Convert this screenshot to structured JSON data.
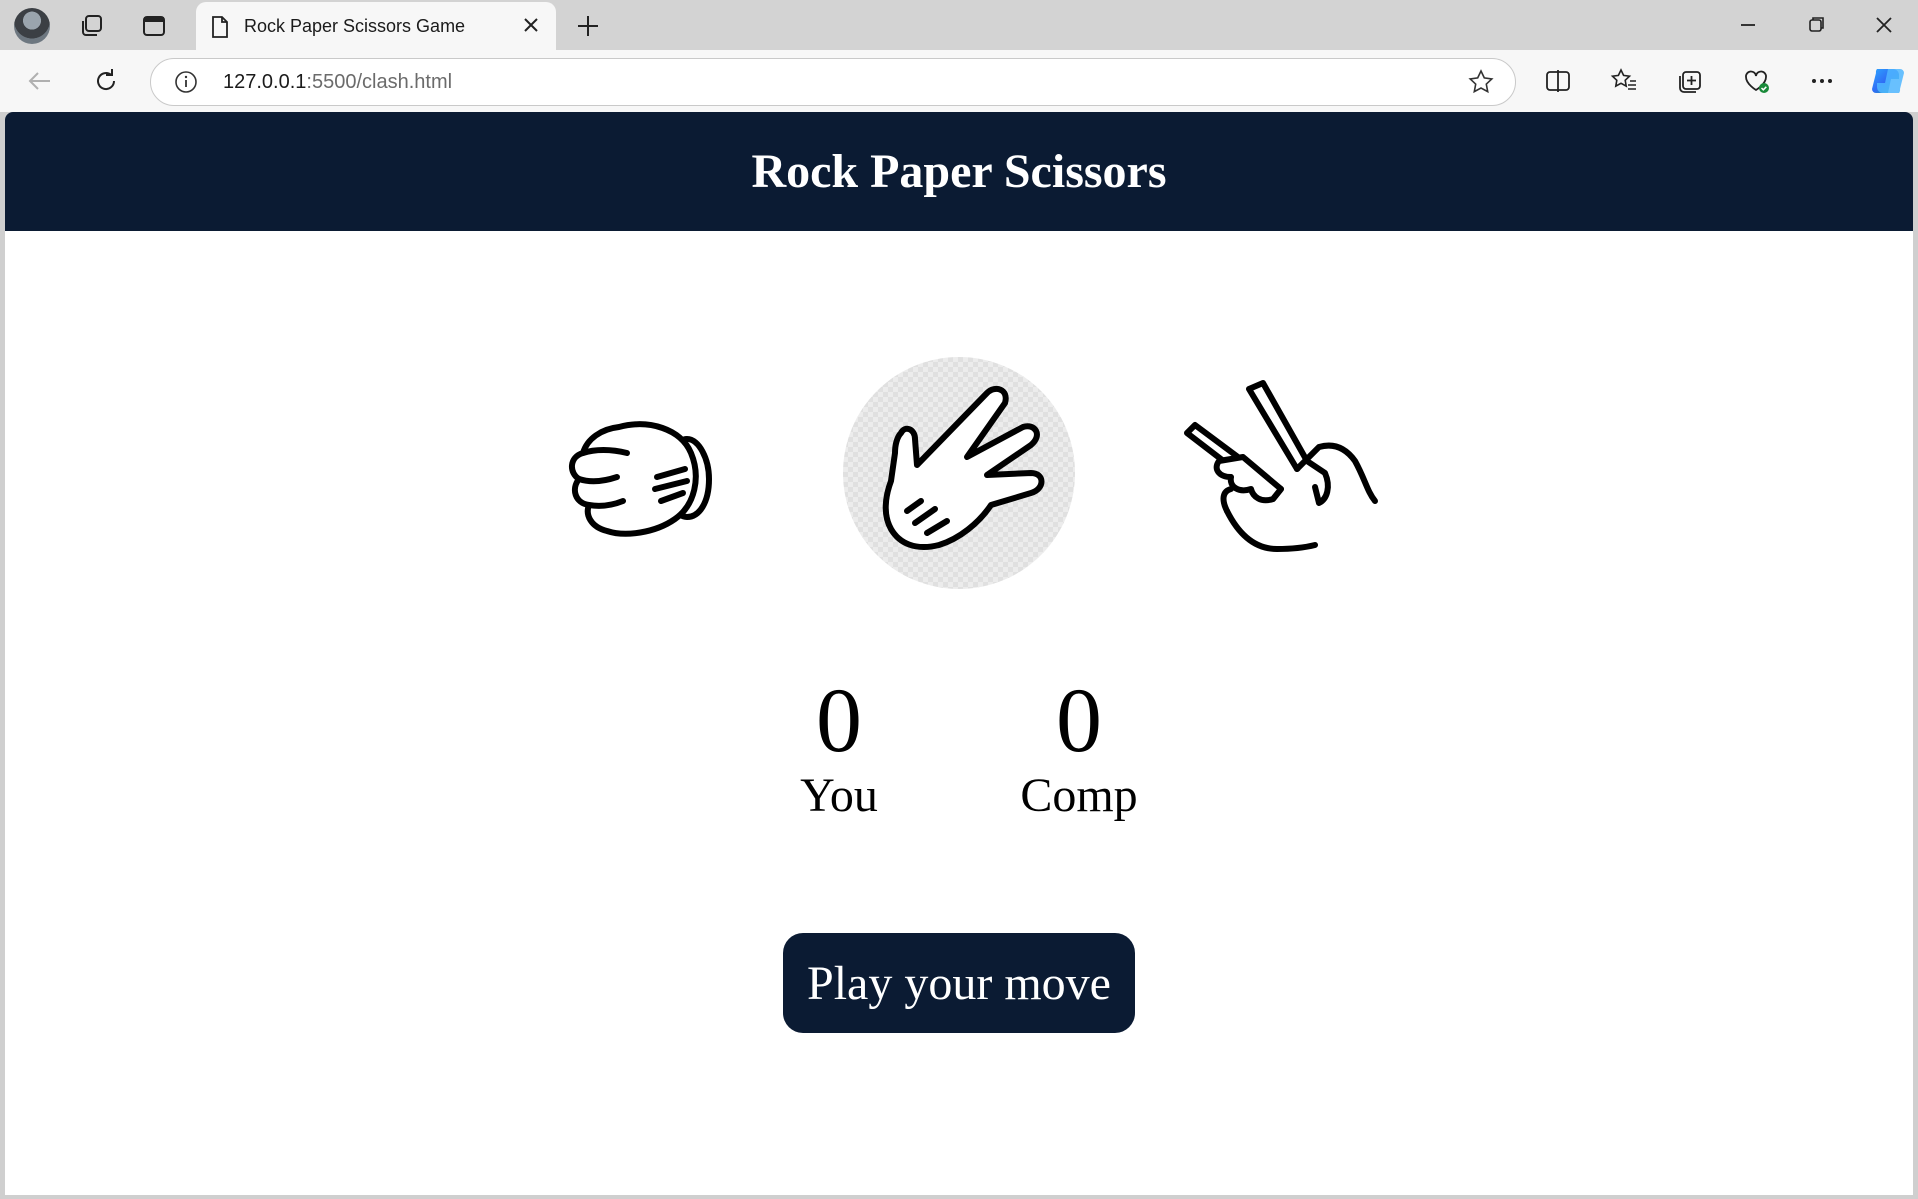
{
  "browser": {
    "tab_title": "Rock Paper Scissors Game",
    "url_host": "127.0.0.1",
    "url_path": ":5500/clash.html"
  },
  "page": {
    "title": "Rock Paper Scissors",
    "choices": [
      {
        "id": "rock",
        "icon": "rock-hand-icon"
      },
      {
        "id": "paper",
        "icon": "paper-hand-icon"
      },
      {
        "id": "scissors",
        "icon": "scissors-hand-icon"
      }
    ],
    "scores": {
      "user_score": "0",
      "user_label": "You",
      "comp_score": "0",
      "comp_label": "Comp"
    },
    "message": "Play your move"
  },
  "colors": {
    "header_bg": "#0b1b33",
    "button_bg": "#0b1b33"
  }
}
